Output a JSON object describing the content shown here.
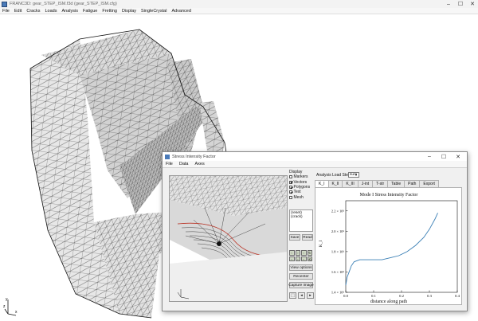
{
  "window": {
    "title": "FRANC3D: gear_STEP_ISM.f3d (gear_STEP_ISM.cfg)",
    "controls": {
      "minimize": "–",
      "maximize": "☐",
      "close": "✕"
    }
  },
  "menubar": {
    "items": [
      "File",
      "Edit",
      "Cracks",
      "Loads",
      "Analysis",
      "Fatigue",
      "Fretting",
      "Display",
      "SingleCrystal",
      "Advanced"
    ]
  },
  "dialog": {
    "title": "Stress Intensity Factor",
    "controls": {
      "minimize": "–",
      "maximize": "☐",
      "close": "✕"
    },
    "menu": [
      "File",
      "Data",
      "Axes"
    ],
    "display_label": "Display",
    "display_options": [
      {
        "label": "Markers",
        "checked": false
      },
      {
        "label": "Vectors",
        "checked": true
      },
      {
        "label": "Polygons",
        "checked": true
      },
      {
        "label": "Text",
        "checked": true
      },
      {
        "label": "Mesh",
        "checked": false
      }
    ],
    "crack_list": [
      "(reset)",
      "(crack)"
    ],
    "buttons": {
      "save": "Save",
      "read": "Read",
      "view_options": "View options",
      "recenter": "Recenter",
      "capture_image": "Capture image"
    },
    "analysis_step_label": "Analysis Load Step",
    "analysis_step_value": "sum",
    "tabs": [
      "K_I",
      "K_II",
      "K_III",
      "J-int",
      "T-str",
      "Table",
      "Path",
      "Export"
    ],
    "active_tab": 0
  },
  "chart_data": {
    "type": "line",
    "title": "Mode I Stress Intensity Factor",
    "xlabel": "distance along path",
    "ylabel": "K_I",
    "xlim": [
      0.0,
      0.4
    ],
    "ylim": [
      1.4,
      2.3
    ],
    "x_ticks": [
      "0.0",
      "0.1",
      "0.2",
      "0.3",
      "0.4"
    ],
    "y_ticks": [
      "1.4 × 10⁶",
      "1.6 × 10⁶",
      "1.8 × 10⁶",
      "2.0 × 10⁶",
      "2.2 × 10⁶"
    ],
    "line_color": "#3a7fb5",
    "x": [
      0.0,
      0.005,
      0.012,
      0.02,
      0.03,
      0.05,
      0.07,
      0.1,
      0.13,
      0.16,
      0.19,
      0.22,
      0.25,
      0.28,
      0.3,
      0.32,
      0.33
    ],
    "y": [
      1.47,
      1.55,
      1.6,
      1.66,
      1.7,
      1.72,
      1.72,
      1.72,
      1.72,
      1.74,
      1.76,
      1.8,
      1.86,
      1.94,
      2.02,
      2.12,
      2.18
    ]
  }
}
